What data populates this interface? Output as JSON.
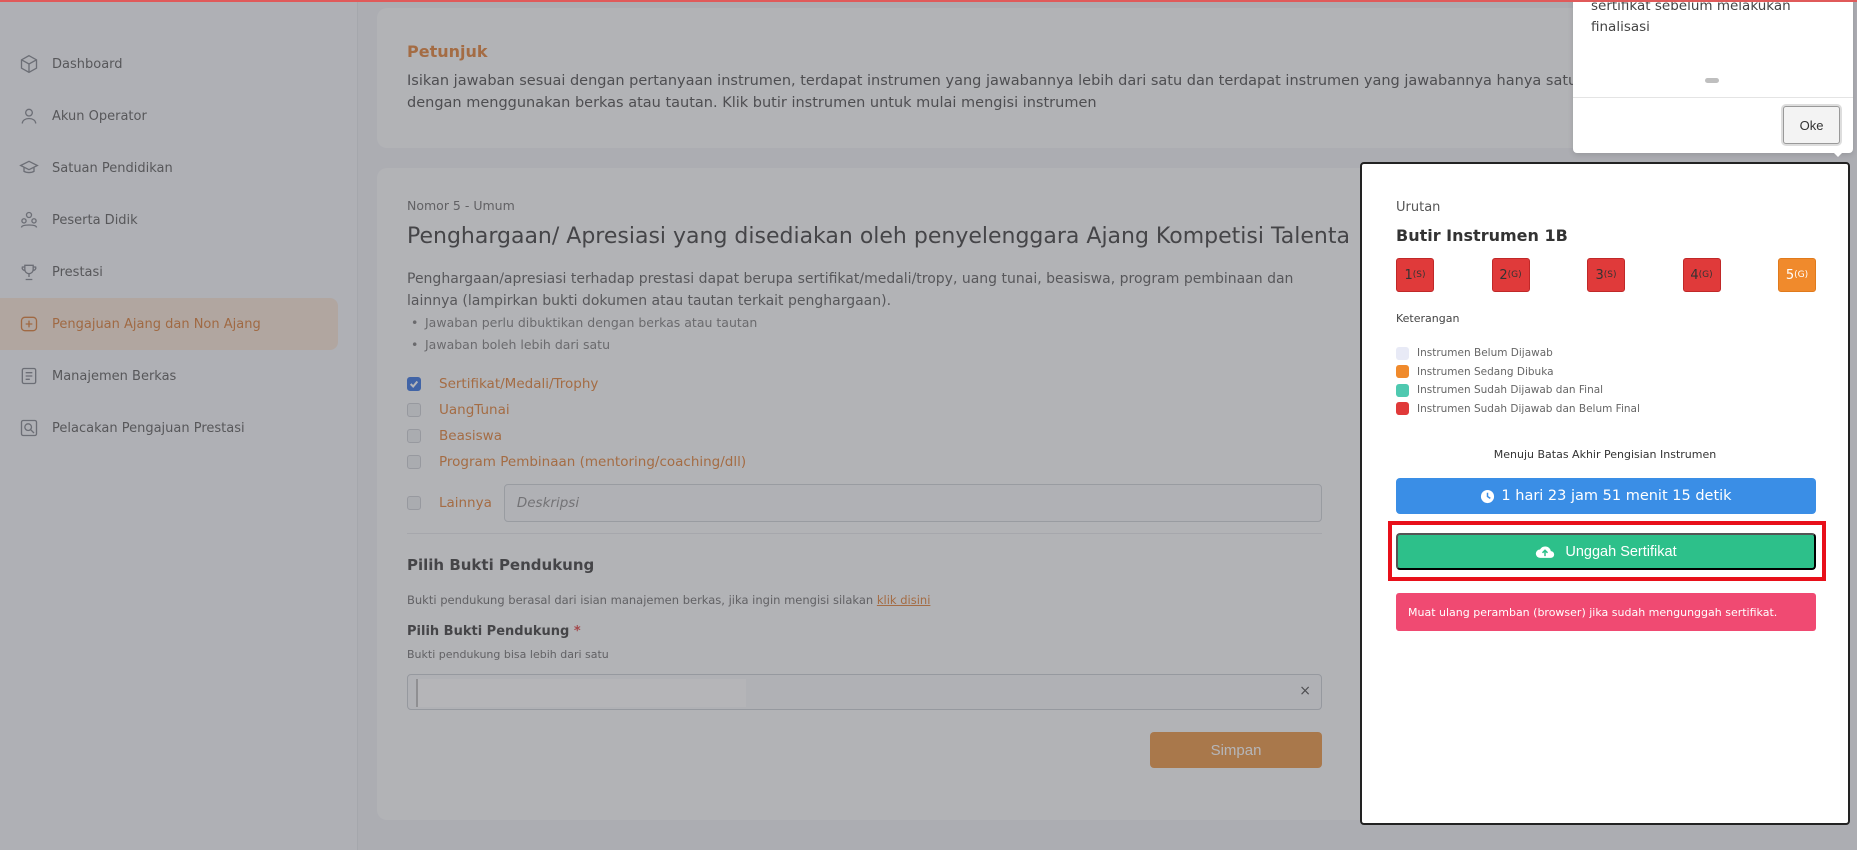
{
  "sidebar": {
    "items": [
      {
        "label": "Dashboard",
        "icon": "cube-icon"
      },
      {
        "label": "Akun Operator",
        "icon": "user-icon"
      },
      {
        "label": "Satuan Pendidikan",
        "icon": "graduation-cap-icon"
      },
      {
        "label": "Peserta Didik",
        "icon": "users-icon"
      },
      {
        "label": "Prestasi",
        "icon": "trophy-icon"
      },
      {
        "label": "Pengajuan Ajang dan Non Ajang",
        "icon": "submission-icon",
        "active": true
      },
      {
        "label": "Manajemen Berkas",
        "icon": "document-icon"
      },
      {
        "label": "Pelacakan Pengajuan Prestasi",
        "icon": "search-document-icon"
      }
    ]
  },
  "petunjuk": {
    "title": "Petunjuk",
    "text_line1": "Isikan jawaban sesuai dengan pertanyaan instrumen, terdapat instrumen yang jawabannya lebih dari satu dan terdapat instrumen yang jawabannya hanya satu. Sebagian",
    "text_line2": "dengan menggunakan berkas atau tautan. Klik butir instrumen untuk mulai mengisi instrumen"
  },
  "question": {
    "meta": "Nomor 5 - Umum",
    "title": "Penghargaan/ Apresiasi yang disediakan oleh penyelenggara Ajang Kompetisi Talenta",
    "description": "Penghargaan/apresiasi terhadap prestasi dapat berupa sertifikat/medali/tropy, uang tunai, beasiswa, program pembinaan dan lainnya (lampirkan bukti dokumen atau tautan terkait penghargaan).",
    "bullets": [
      "Jawaban perlu dibuktikan dengan berkas atau tautan",
      "Jawaban boleh lebih dari satu"
    ],
    "options": [
      {
        "label": "Sertifikat/Medali/Trophy",
        "checked": true
      },
      {
        "label": "UangTunai",
        "checked": false
      },
      {
        "label": "Beasiswa",
        "checked": false
      },
      {
        "label": "Program Pembinaan (mentoring/coaching/dll)",
        "checked": false
      }
    ],
    "other_label": "Lainnya",
    "other_placeholder": "Deskripsi"
  },
  "bukti": {
    "title": "Pilih Bukti Pendukung",
    "note": "Bukti pendukung berasal dari isian manajemen berkas, jika ingin mengisi silakan",
    "note_link": "klik disini",
    "label": "Pilih Bukti Pendukung",
    "required_mark": "*",
    "sub": "Bukti pendukung bisa lebih dari satu",
    "clear": "×",
    "save_label": "Simpan"
  },
  "panel": {
    "urutan": "Urutan",
    "title": "Butir Instrumen 1B",
    "items": [
      {
        "num": "1",
        "sub": "(S)",
        "state": "answered-not-final"
      },
      {
        "num": "2",
        "sub": "(G)",
        "state": "answered-not-final"
      },
      {
        "num": "3",
        "sub": "(S)",
        "state": "answered-not-final"
      },
      {
        "num": "4",
        "sub": "(G)",
        "state": "answered-not-final"
      },
      {
        "num": "5",
        "sub": "(G)",
        "state": "open"
      }
    ],
    "keterangan": "Keterangan",
    "legend": [
      {
        "label": "Instrumen Belum Dijawab",
        "color": "#e8eaf6"
      },
      {
        "label": "Instrumen Sedang Dibuka",
        "color": "#f08a2c"
      },
      {
        "label": "Instrumen Sudah Dijawab dan Final",
        "color": "#4fc9b0"
      },
      {
        "label": "Instrumen Sudah Dijawab dan Belum Final",
        "color": "#e03a3a"
      }
    ],
    "batas": "Menuju Batas Akhir Pengisian Instrumen",
    "timer": "1 hari 23 jam 51 menit 15 detik",
    "upload_label": "Unggah Sertifikat",
    "alert": "Muat ulang peramban (browser) jika sudah mengunggah sertifikat."
  },
  "tooltip": {
    "text_line1": "sertifikat sebelum melakukan",
    "text_line2": "finalisasi",
    "ok_label": "Oke"
  },
  "colors": {
    "accent": "#e07b2c",
    "timer": "#3a8ee6",
    "upload": "#2dc08a",
    "alert": "#f04a72",
    "highlight": "#e8101a"
  }
}
